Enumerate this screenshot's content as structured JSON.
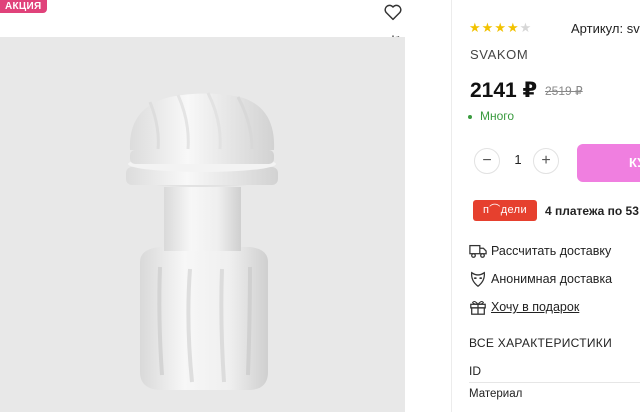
{
  "gallery": {
    "badge": "АКЦИЯ",
    "favorite_icon": "heart-icon",
    "compare_icon": "compare-scales-icon"
  },
  "product": {
    "rating": 4,
    "rating_max": 5,
    "sku_label": "Артикул: sv",
    "brand": "SVAKOM",
    "price": "2141 ₽",
    "old_price": "2519 ₽",
    "stock": "Много",
    "quantity": "1",
    "qty_minus": "−",
    "qty_plus": "+",
    "buy_label": "ку"
  },
  "podeli": {
    "logo": "п⌒дели",
    "text": "4 платежа по 53"
  },
  "actions": [
    {
      "label": "Рассчитать доставку",
      "icon": "truck-icon"
    },
    {
      "label": "Анонимная доставка",
      "icon": "anonymous-mask-icon"
    },
    {
      "label": "Хочу в подарок",
      "icon": "gift-icon"
    }
  ],
  "specs": {
    "title": "ВСЕ ХАРАКТЕРИСТИКИ",
    "rows": [
      "ID",
      "Материал"
    ]
  },
  "colors": {
    "badge": "#e0427a",
    "buy": "#f07fe0",
    "podeli": "#e6402e",
    "stock": "#3a9b3f",
    "star": "#f2c200"
  }
}
